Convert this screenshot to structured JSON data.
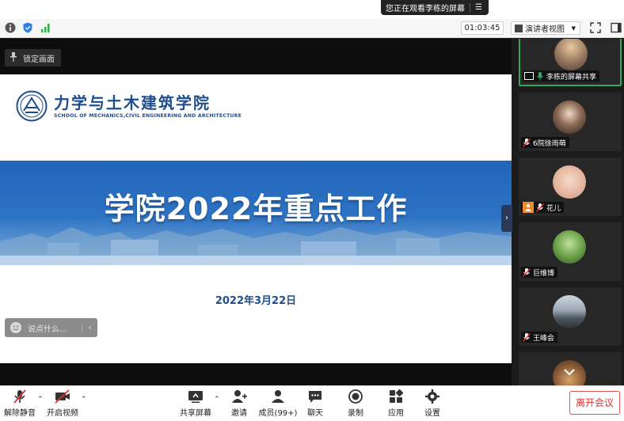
{
  "top_notice": {
    "text": "您正在观看李栋的屏幕",
    "menu_icon": "menu-icon"
  },
  "toolbar": {
    "timer": "01:03:45",
    "view_label": "演讲者视图",
    "icons": [
      "info-icon",
      "shield-icon",
      "signal-icon",
      "fullscreen-icon",
      "sidebar-icon"
    ]
  },
  "share": {
    "lock_label": "锁定画面",
    "slide": {
      "school_cn": "力学与土木建筑学院",
      "school_en": "SCHOOL OF MECHANICS,CIVIL ENGINEERING AND ARCHITECTURE",
      "headline": "学院2022年重点工作",
      "date": "2022年3月22日"
    },
    "chat_placeholder": "说点什么...",
    "chat_arrow": "‹",
    "collapse_arrow": "›"
  },
  "gallery": {
    "tiles": [
      {
        "name": "李栋的屏幕共享",
        "active": true
      },
      {
        "name": "6院徐雨萌",
        "active": false
      },
      {
        "name": "花儿",
        "active": false
      },
      {
        "name": "巨维博",
        "active": false
      },
      {
        "name": "王峰会",
        "active": false
      }
    ]
  },
  "bottombar": {
    "unmute": "解除静音",
    "start_video": "开启视频",
    "share_screen": "共享屏幕",
    "invite": "邀请",
    "members": "成员(99+)",
    "chat": "聊天",
    "record": "录制",
    "apps": "应用",
    "settings": "设置",
    "leave": "离开会议"
  },
  "colors": {
    "brand_blue": "#1f4d8f",
    "leave_red": "#e03030",
    "active_green": "#3ba55c"
  }
}
